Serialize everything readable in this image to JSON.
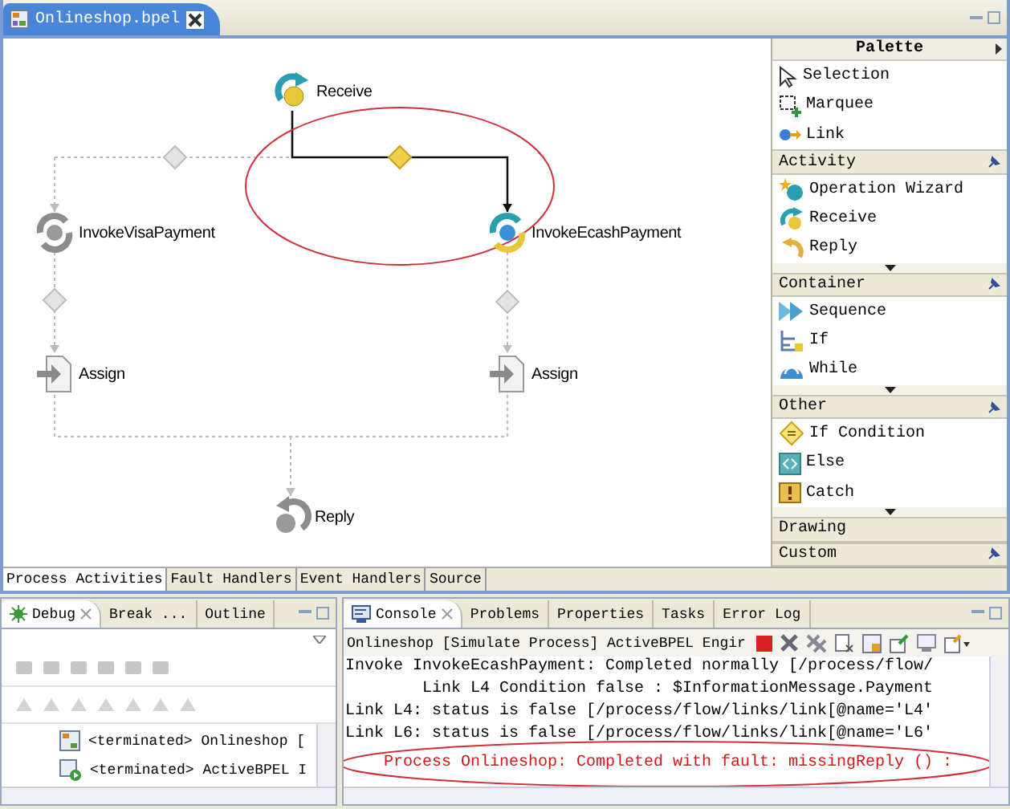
{
  "editor": {
    "tab": {
      "title": "Onlineshop.bpel"
    },
    "activities": [
      {
        "kind": "receive",
        "label": "Receive",
        "executed": true
      },
      {
        "kind": "invoke",
        "label": "InvokeVisaPayment",
        "executed": false
      },
      {
        "kind": "invoke",
        "label": "InvokeEcashPayment",
        "executed": true
      },
      {
        "kind": "assign",
        "label": "Assign",
        "executed": false
      },
      {
        "kind": "assign",
        "label": "Assign",
        "executed": false
      },
      {
        "kind": "reply",
        "label": "Reply",
        "executed": false
      }
    ],
    "links": [
      {
        "active": false
      },
      {
        "active": true
      },
      {
        "active": false
      },
      {
        "active": false
      }
    ],
    "palette": {
      "title": "Palette",
      "tools": [
        {
          "kind": "selection",
          "label": "Selection"
        },
        {
          "kind": "marquee",
          "label": "Marquee"
        },
        {
          "kind": "link",
          "label": "Link"
        }
      ],
      "drawers": [
        {
          "label": "Activity",
          "pinned": true,
          "expanded": true,
          "items": [
            {
              "kind": "wizard",
              "label": "Operation Wizard"
            },
            {
              "kind": "receive",
              "label": "Receive"
            },
            {
              "kind": "reply",
              "label": "Reply"
            }
          ]
        },
        {
          "label": "Container",
          "pinned": true,
          "expanded": true,
          "items": [
            {
              "kind": "sequence",
              "label": "Sequence"
            },
            {
              "kind": "if",
              "label": "If"
            },
            {
              "kind": "while",
              "label": "While"
            }
          ]
        },
        {
          "label": "Other",
          "pinned": true,
          "expanded": true,
          "items": [
            {
              "kind": "condition",
              "label": "If Condition"
            },
            {
              "kind": "else",
              "label": "Else"
            },
            {
              "kind": "catch",
              "label": "Catch"
            }
          ]
        },
        {
          "label": "Drawing",
          "pinned": false,
          "expanded": false
        },
        {
          "label": "Custom",
          "pinned": true,
          "expanded": false
        }
      ]
    },
    "bottom_tabs": [
      {
        "label": "Process Activities",
        "selected": true
      },
      {
        "label": "Fault Handlers",
        "selected": false
      },
      {
        "label": "Event Handlers",
        "selected": false
      },
      {
        "label": "Source",
        "selected": false
      }
    ]
  },
  "debug": {
    "tabs": [
      {
        "label": "Debug",
        "selected": true
      },
      {
        "label": "Break ...",
        "selected": false
      },
      {
        "label": "Outline",
        "selected": false
      }
    ],
    "tree": [
      {
        "kind": "process",
        "label": "<terminated> Onlineshop ["
      },
      {
        "kind": "engine",
        "label": "<terminated> ActiveBPEL I"
      }
    ]
  },
  "console": {
    "tabs": [
      {
        "label": "Console",
        "selected": true
      },
      {
        "label": "Problems",
        "selected": false
      },
      {
        "label": "Properties",
        "selected": false
      },
      {
        "label": "Tasks",
        "selected": false
      },
      {
        "label": "Error Log",
        "selected": false
      }
    ],
    "description": "Onlineshop [Simulate Process] ActiveBPEL Engir",
    "lines": [
      {
        "kind": "normal",
        "text": "Invoke InvokeEcashPayment: Completed normally [/process/flow/"
      },
      {
        "kind": "normal",
        "text": "        Link L4 Condition false : $InformationMessage.Payment"
      },
      {
        "kind": "normal",
        "text": "Link L4: status is false [/process/flow/links/link[@name='L4'"
      },
      {
        "kind": "normal",
        "text": "Link L6: status is false [/process/flow/links/link[@name='L6'"
      },
      {
        "kind": "error",
        "text": "Process Onlineshop: Completed with fault: missingReply () :"
      }
    ]
  }
}
